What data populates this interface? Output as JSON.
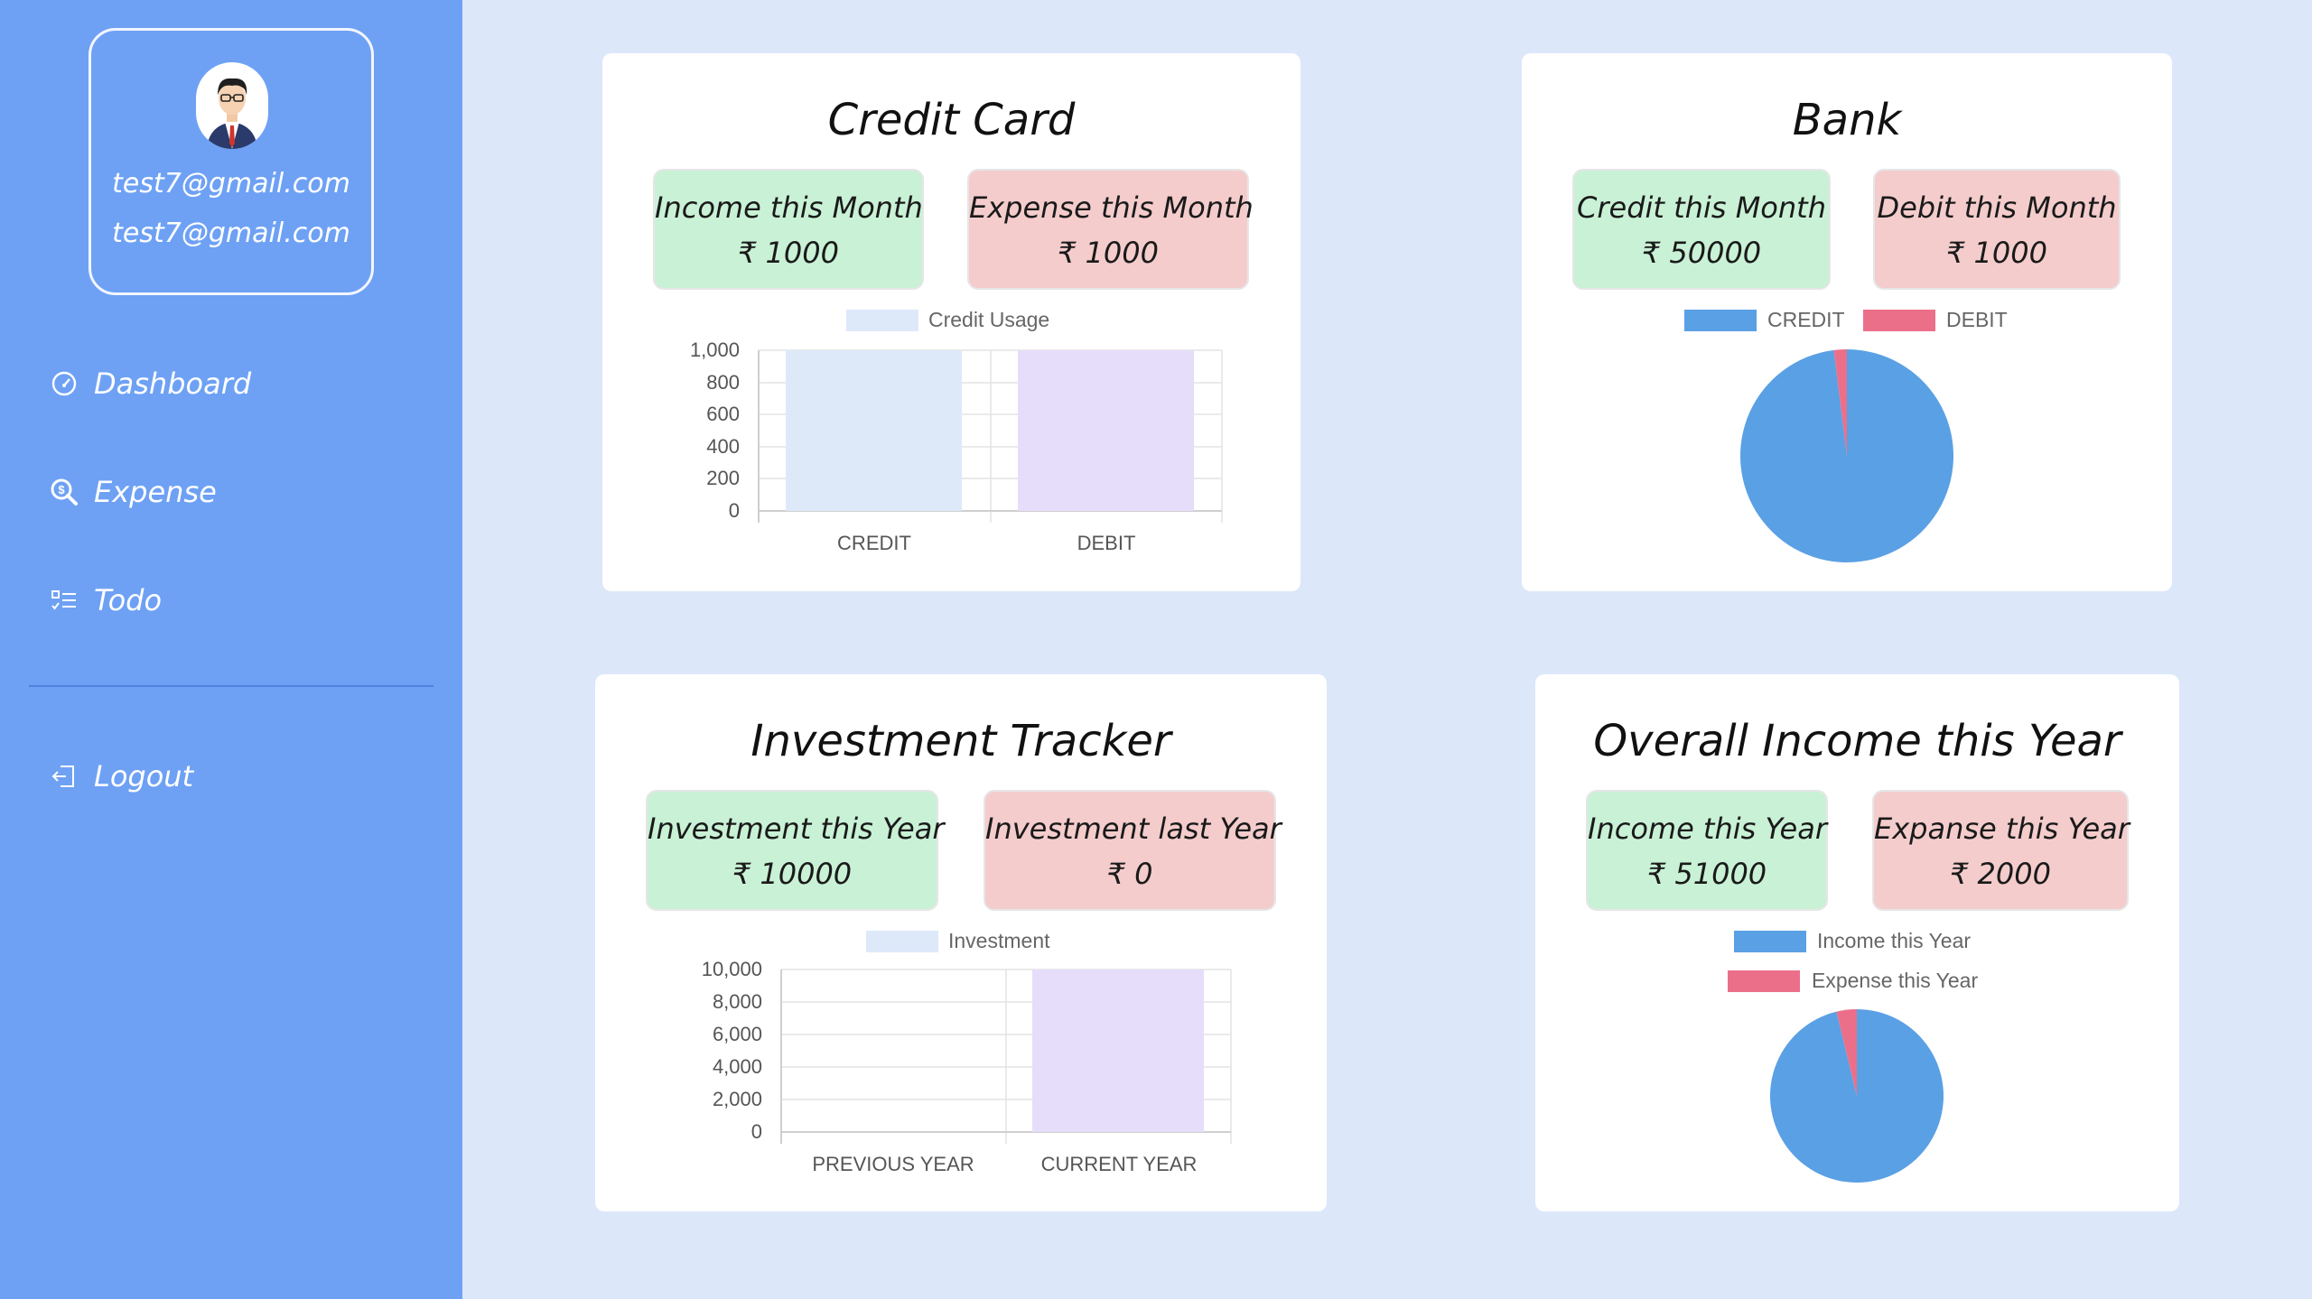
{
  "user": {
    "name": "test7@gmail.com",
    "email": "test7@gmail.com"
  },
  "nav": [
    {
      "label": "Dashboard",
      "icon": "dashboard-gauge-icon"
    },
    {
      "label": "Expense",
      "icon": "search-dollar-icon"
    },
    {
      "label": "Todo",
      "icon": "checklist-icon"
    },
    {
      "label": "Logout",
      "icon": "logout-icon"
    }
  ],
  "colors": {
    "sidebar": "#6ea1f4",
    "background": "#dde7fa",
    "green": "#c9f1d6",
    "red": "#f4cccc",
    "pie_blue": "#5aa0e4",
    "pie_pink": "#ec6f8a",
    "bar_blue": "#dde9f9",
    "bar_purple": "#e6ddfa"
  },
  "credit_card": {
    "title": "Credit Card",
    "income_label": "Income this Month",
    "income_value": "₹ 1000",
    "expense_label": "Expense this Month",
    "expense_value": "₹ 1000"
  },
  "bank": {
    "title": "Bank",
    "credit_label": "Credit this Month",
    "credit_value": "₹ 50000",
    "debit_label": "Debit this Month",
    "debit_value": "₹ 1000"
  },
  "investment": {
    "title": "Investment Tracker",
    "this_year_label": "Investment this Year",
    "this_year_value": "₹ 10000",
    "last_year_label": "Investment last Year",
    "last_year_value": "₹ 0"
  },
  "overall": {
    "title": "Overall Income this Year",
    "income_label": "Income this Year",
    "income_value": "₹ 51000",
    "expense_label": "Expanse this Year",
    "expense_value": "₹ 2000"
  },
  "chart_data": [
    {
      "type": "bar",
      "legend": [
        "Credit Usage"
      ],
      "categories": [
        "CREDIT",
        "DEBIT"
      ],
      "values": [
        1000,
        1000
      ],
      "ylim": [
        0,
        1000
      ],
      "yticks": [
        "1,000",
        "800",
        "600",
        "400",
        "200",
        "0"
      ]
    },
    {
      "type": "pie",
      "legend": [
        "CREDIT",
        "DEBIT"
      ],
      "values": [
        50000,
        1000
      ]
    },
    {
      "type": "bar",
      "legend": [
        "Investment"
      ],
      "categories": [
        "PREVIOUS YEAR",
        "CURRENT YEAR"
      ],
      "values": [
        0,
        10000
      ],
      "ylim": [
        0,
        10000
      ],
      "yticks": [
        "10,000",
        "8,000",
        "6,000",
        "4,000",
        "2,000",
        "0"
      ]
    },
    {
      "type": "pie",
      "legend": [
        "Income this Year",
        "Expense this Year"
      ],
      "values": [
        51000,
        2000
      ]
    }
  ]
}
